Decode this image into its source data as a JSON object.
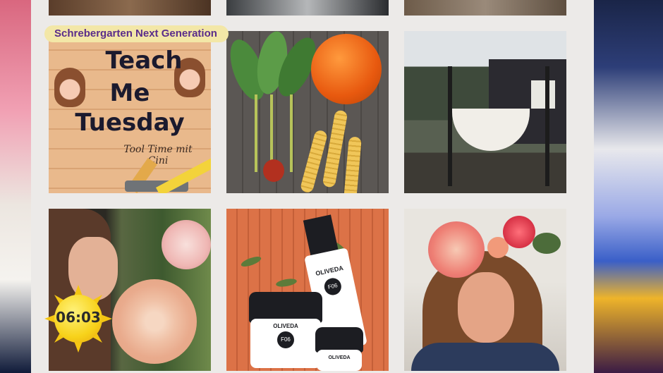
{
  "caption": {
    "text": "Schrebergarten Next Generation"
  },
  "teach_tile": {
    "line1": "Teach",
    "line2": "Me",
    "line3": "Tuesday",
    "subtitle": "Tool Time mit Cini"
  },
  "products": {
    "brand": "OLIVEDA",
    "number": "F06"
  },
  "clock": {
    "time": "06:03"
  },
  "colors": {
    "caption_bg": "#f3e7a7",
    "caption_text": "#5a2c8a",
    "clock_sun": "#f7d21a",
    "panel_bg": "#eceae8"
  }
}
